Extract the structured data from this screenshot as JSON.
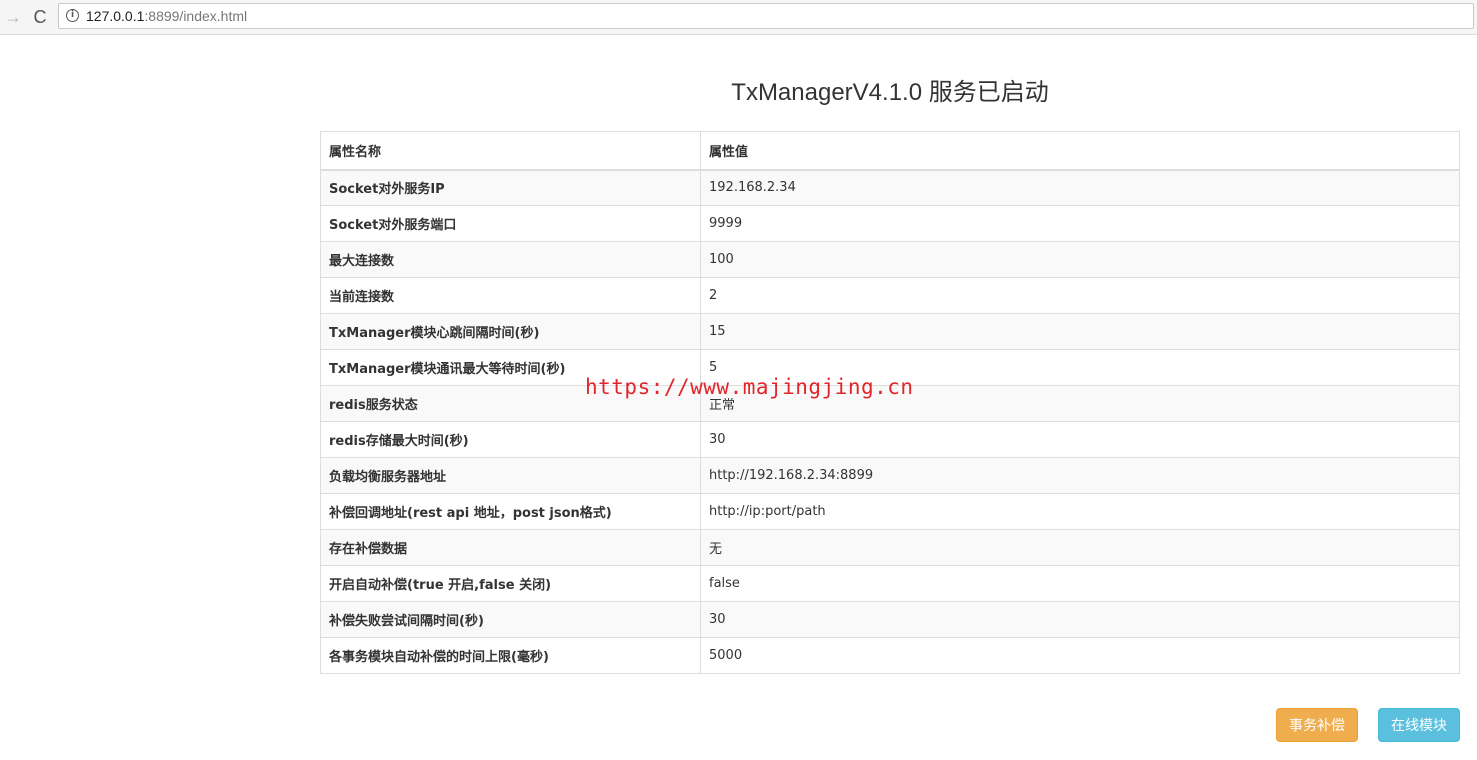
{
  "browser": {
    "forward_glyph": "→",
    "reload_glyph": "C",
    "info_glyph": "i",
    "url_host": "127.0.0.1",
    "url_rest": ":8899/index.html"
  },
  "page": {
    "title": "TxManagerV4.1.0 服务已启动"
  },
  "table": {
    "headers": [
      "属性名称",
      "属性值"
    ],
    "rows": [
      {
        "name": "Socket对外服务IP",
        "value": "192.168.2.34"
      },
      {
        "name": "Socket对外服务端口",
        "value": "9999"
      },
      {
        "name": "最大连接数",
        "value": "100"
      },
      {
        "name": "当前连接数",
        "value": "2"
      },
      {
        "name": "TxManager模块心跳间隔时间(秒)",
        "value": "15"
      },
      {
        "name": "TxManager模块通讯最大等待时间(秒)",
        "value": "5"
      },
      {
        "name": "redis服务状态",
        "value": "正常"
      },
      {
        "name": "redis存储最大时间(秒)",
        "value": "30"
      },
      {
        "name": "负载均衡服务器地址",
        "value": "http://192.168.2.34:8899"
      },
      {
        "name": "补偿回调地址(rest api 地址，post json格式)",
        "value": "http://ip:port/path"
      },
      {
        "name": "存在补偿数据",
        "value": "无"
      },
      {
        "name": "开启自动补偿(true 开启,false 关闭)",
        "value": "false"
      },
      {
        "name": "补偿失败尝试间隔时间(秒)",
        "value": "30"
      },
      {
        "name": "各事务模块自动补偿的时间上限(毫秒)",
        "value": "5000"
      }
    ]
  },
  "watermark": "https://www.majingjing.cn",
  "buttons": {
    "compensate_label": "事务补偿",
    "online_label": "在线模块"
  },
  "colors": {
    "compensate_button": "#f0ad4e",
    "online_button": "#5bc0de",
    "watermark": "#e0262a"
  }
}
